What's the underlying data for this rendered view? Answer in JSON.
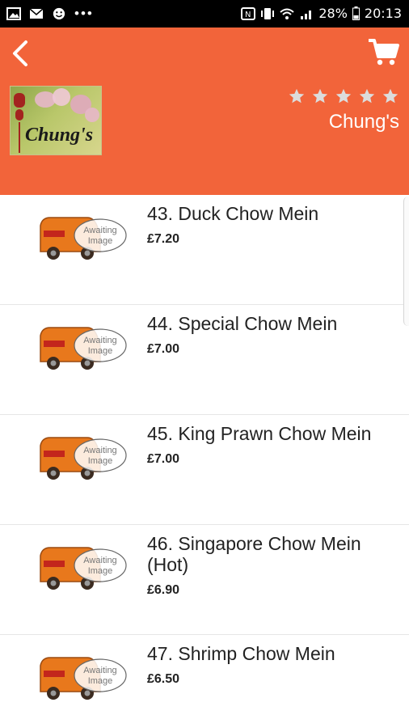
{
  "status_bar": {
    "battery": "28%",
    "time": "20:13",
    "dots": "•••"
  },
  "header": {
    "shop_name": "Chung's",
    "logo_text": "Chung's",
    "rating": 5,
    "colors": {
      "accent": "#f2643a",
      "star": "#dcdcdc"
    }
  },
  "items": [
    {
      "name": "43. Duck Chow Mein",
      "price": "£7.20",
      "image_text": [
        "Awaiting",
        "Image"
      ]
    },
    {
      "name": "44. Special Chow Mein",
      "price": "£7.00",
      "image_text": [
        "Awaiting",
        "Image"
      ]
    },
    {
      "name": "45. King Prawn Chow Mein",
      "price": "£7.00",
      "image_text": [
        "Awaiting",
        "Image"
      ]
    },
    {
      "name": "46. Singapore Chow Mein (Hot)",
      "price": "£6.90",
      "image_text": [
        "Awaiting",
        "Image"
      ]
    },
    {
      "name": "47. Shrimp Chow Mein",
      "price": "£6.50",
      "image_text": [
        "Awaiting",
        "Image"
      ]
    }
  ]
}
